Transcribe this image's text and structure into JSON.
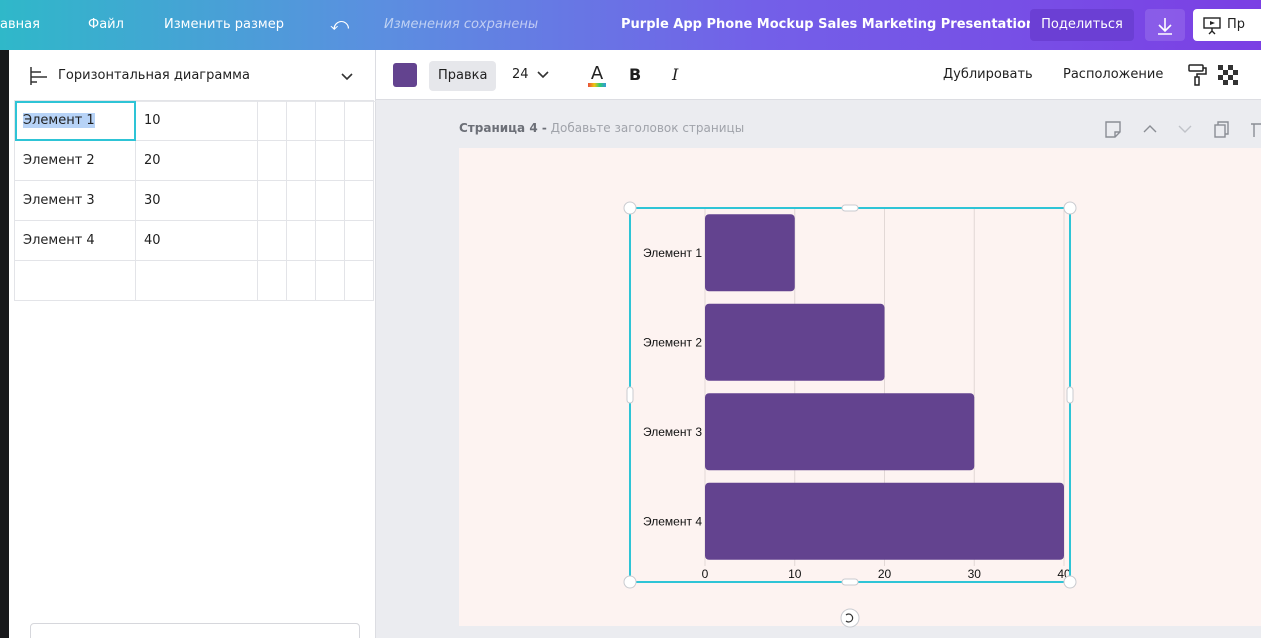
{
  "topbar": {
    "home_label": "авная",
    "file_label": "Файл",
    "resize_label": "Изменить размер",
    "saved_status": "Изменения сохранены",
    "design_title": "Purple App Phone Mockup Sales Marketing Presentation",
    "share_label": "Поделиться",
    "present_label": "Пр"
  },
  "sidebar": {
    "chart_type_label": "Горизонтальная диаграмма",
    "table": {
      "rows": [
        {
          "name": "Элемент 1",
          "value": "10"
        },
        {
          "name": "Элемент 2",
          "value": "20"
        },
        {
          "name": "Элемент 3",
          "value": "30"
        },
        {
          "name": "Элемент 4",
          "value": "40"
        }
      ]
    }
  },
  "toolbar": {
    "color": "#63438f",
    "font_label": "Правка",
    "font_size": "24",
    "bold_label": "B",
    "italic_label": "I",
    "duplicate_label": "Дублировать",
    "position_label": "Расположение"
  },
  "page": {
    "label_bold": "Страница 4 -",
    "label_hint": "Добавьте заголовок страницы"
  },
  "colors": {
    "accent": "#2ec4d6",
    "bar": "#63438f",
    "page_bg": "#fdf3f1"
  },
  "chart_data": {
    "type": "bar",
    "orientation": "horizontal",
    "categories": [
      "Элемент 1",
      "Элемент 2",
      "Элемент 3",
      "Элемент 4"
    ],
    "values": [
      10,
      20,
      30,
      40
    ],
    "xlim": [
      0,
      40
    ],
    "xticks": [
      0,
      10,
      20,
      30,
      40
    ],
    "grid": true,
    "legend": "none"
  }
}
